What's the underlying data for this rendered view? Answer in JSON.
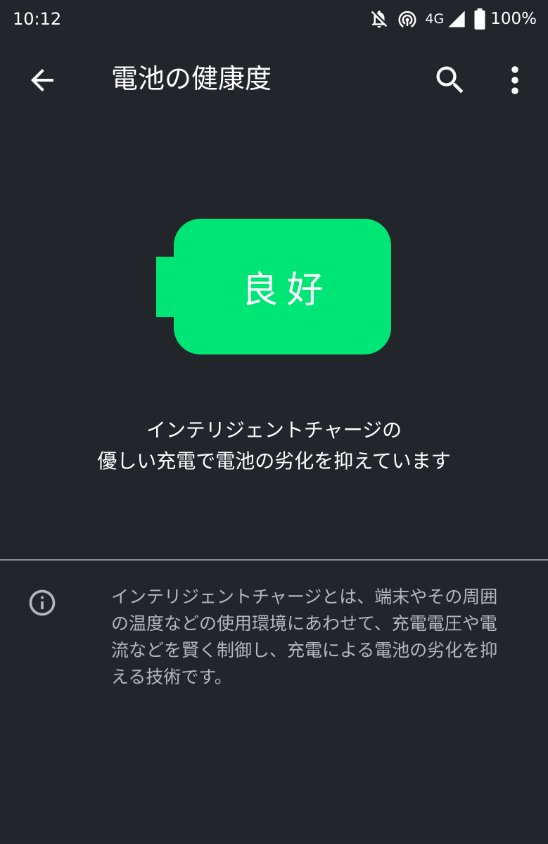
{
  "status_bar": {
    "time": "10:12",
    "network_label": "4G",
    "battery_percent": "100%",
    "icons": [
      "notifications-off-icon",
      "hotspot-icon",
      "signal-icon",
      "battery-icon"
    ]
  },
  "app_bar": {
    "title": "電池の健康度",
    "icons": [
      "back-arrow-icon",
      "search-icon",
      "more-vert-icon"
    ]
  },
  "battery": {
    "status_label": "良好",
    "color": "#00e676"
  },
  "summary": {
    "lines": [
      "インテリジェントチャージの",
      "優しい充電で電池の劣化を抑えています"
    ]
  },
  "info": {
    "icon": "info-icon",
    "lines": [
      "インテリジェントチャージとは、端末やその周囲",
      "の温度などの使用環境にあわせて、充電電圧や電",
      "流などを賢く制御し、充電による電池の劣化を抑",
      "える技術です。"
    ]
  },
  "colors": {
    "background": "#22262a",
    "text_primary": "#ffffff",
    "text_secondary": "#b4b8bc",
    "divider": "#8a8e92"
  }
}
